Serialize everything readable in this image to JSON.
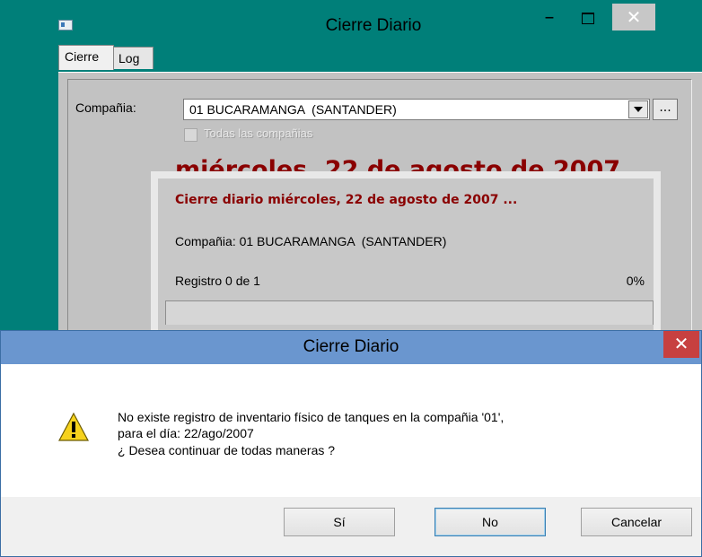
{
  "main_window": {
    "title": "Cierre Diario",
    "minimize_label": "–",
    "close_label": "✕",
    "tabs": [
      {
        "label": "Cierre"
      },
      {
        "label": "Log"
      }
    ],
    "compania_label": "Compañia:",
    "company_selected": "01 BUCARAMANGA  (SANTANDER)",
    "browse_label": "...",
    "todas_label": "Todas las compañias",
    "date_heading": "miércoles, 22 de agosto de 2007"
  },
  "progress": {
    "title": "Cierre diario miércoles, 22 de agosto de 2007 ...",
    "company_text": "Compañia: 01 BUCARAMANGA  (SANTANDER)",
    "registro_text": "Registro 0 de 1",
    "percent_text": "0%",
    "fraction": 0
  },
  "message_box": {
    "title": "Cierre Diario",
    "close_label": "✕",
    "icon": "warning-icon",
    "line1": "No existe registro de inventario físico de tanques en la compañia '01',",
    "line2": "para el día: 22/ago/2007",
    "line3": "¿ Desea continuar de todas maneras ?",
    "buttons": {
      "yes": "Sí",
      "no": "No",
      "cancel": "Cancelar"
    }
  },
  "colors": {
    "window_frame": "#007f79",
    "dialog_title": "#6a96cf",
    "date_text": "#8a0000",
    "close_red": "#c74040"
  }
}
